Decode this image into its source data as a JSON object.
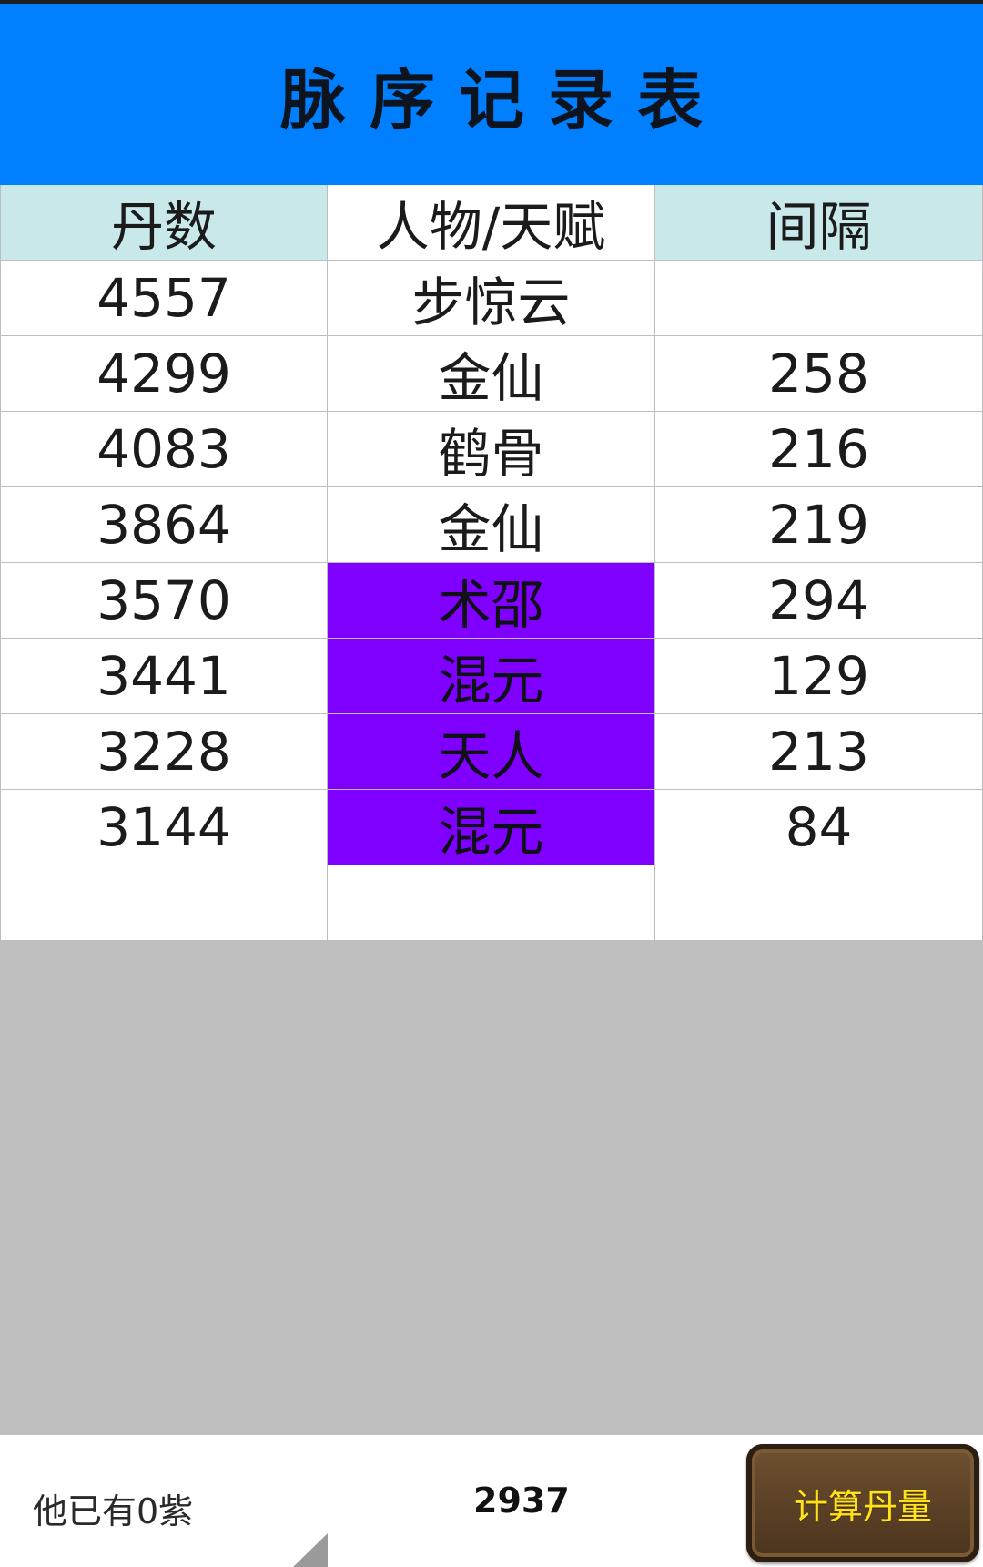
{
  "header": {
    "title": "脉序记录表"
  },
  "table": {
    "columns": [
      "丹数",
      "人物/天赋",
      "间隔"
    ],
    "rows": [
      {
        "dan": "4557",
        "name": "步惊云",
        "interval": "",
        "highlight": false
      },
      {
        "dan": "4299",
        "name": "金仙",
        "interval": "258",
        "highlight": false
      },
      {
        "dan": "4083",
        "name": "鹤骨",
        "interval": "216",
        "highlight": false
      },
      {
        "dan": "3864",
        "name": "金仙",
        "interval": "219",
        "highlight": false
      },
      {
        "dan": "3570",
        "name": "术邵",
        "interval": "294",
        "highlight": true
      },
      {
        "dan": "3441",
        "name": "混元",
        "interval": "129",
        "highlight": true
      },
      {
        "dan": "3228",
        "name": "天人",
        "interval": "213",
        "highlight": true
      },
      {
        "dan": "3144",
        "name": "混元",
        "interval": "84",
        "highlight": true
      },
      {
        "dan": "",
        "name": "",
        "interval": "",
        "highlight": false
      }
    ]
  },
  "colors": {
    "header_bg": "#0080ff",
    "column_header_bg": "#c8e8ea",
    "highlight_bg": "#7f00ff",
    "empty_area_bg": "#bfbfbf",
    "button_text": "#ffe21a"
  },
  "footer": {
    "status_text": "他已有0紫",
    "count_value": "2937",
    "calc_button_label": "计算丹量"
  }
}
